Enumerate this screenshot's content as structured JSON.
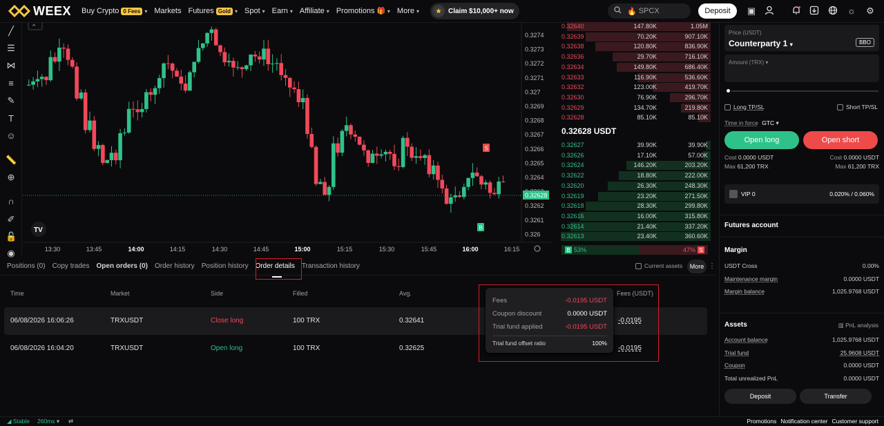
{
  "brand": {
    "name": "WEEX"
  },
  "nav": [
    {
      "label": "Buy Crypto",
      "badge": "0 Fees",
      "chevron": true
    },
    {
      "label": "Markets",
      "chevron": false
    },
    {
      "label": "Futures",
      "badge": "Gold",
      "chevron": true
    },
    {
      "label": "Spot",
      "chevron": true
    },
    {
      "label": "Earn",
      "chevron": true
    },
    {
      "label": "Affiliate",
      "chevron": true
    },
    {
      "label": "Promotions",
      "badge": "🎁",
      "chevron": true
    },
    {
      "label": "More",
      "chevron": true
    }
  ],
  "claim_label": "Claim $10,000+ now",
  "search": {
    "placeholder": "SPCX"
  },
  "deposit_label": "Deposit",
  "chart": {
    "price_axis": [
      "0.3274",
      "0.3273",
      "0.3272",
      "0.3271",
      "0.327",
      "0.3269",
      "0.3268",
      "0.3267",
      "0.3266",
      "0.3265",
      "0.3264",
      "0.3263",
      "0.3262",
      "0.3261",
      "0.326"
    ],
    "current_price": "0.32628",
    "time_axis": [
      "13:30",
      "13:45",
      "14:00",
      "14:15",
      "14:30",
      "14:45",
      "15:00",
      "15:15",
      "15:30",
      "15:45",
      "16:00",
      "16:15"
    ],
    "bold_times": [
      "14:00",
      "15:00",
      "16:00"
    ],
    "markers": {
      "sell": "S",
      "buy": "B"
    },
    "up_color": "#2ec28a",
    "down_color": "#f1495a",
    "tv_logo": "TV"
  },
  "orderbook": {
    "asks": [
      {
        "price": "0.32640",
        "amount": "147.80K",
        "total": "1.05M",
        "depth": 0.92
      },
      {
        "price": "0.32639",
        "amount": "70.20K",
        "total": "907.10K",
        "depth": 0.8
      },
      {
        "price": "0.32638",
        "amount": "120.80K",
        "total": "836.90K",
        "depth": 0.74
      },
      {
        "price": "0.32636",
        "amount": "29.70K",
        "total": "716.10K",
        "depth": 0.63
      },
      {
        "price": "0.32634",
        "amount": "149.80K",
        "total": "686.40K",
        "depth": 0.6
      },
      {
        "price": "0.32633",
        "amount": "116.90K",
        "total": "536.60K",
        "depth": 0.47
      },
      {
        "price": "0.32632",
        "amount": "123.00K",
        "total": "419.70K",
        "depth": 0.37
      },
      {
        "price": "0.32630",
        "amount": "76.90K",
        "total": "296.70K",
        "depth": 0.26
      },
      {
        "price": "0.32629",
        "amount": "134.70K",
        "total": "219.80K",
        "depth": 0.19
      },
      {
        "price": "0.32628",
        "amount": "85.10K",
        "total": "85.10K",
        "depth": 0.08
      }
    ],
    "mid_price": "0.32628 USDT",
    "bids": [
      {
        "price": "0.32627",
        "amount": "39.90K",
        "total": "39.90K",
        "depth": 0.03
      },
      {
        "price": "0.32626",
        "amount": "17.10K",
        "total": "57.00K",
        "depth": 0.05
      },
      {
        "price": "0.32624",
        "amount": "146.20K",
        "total": "203.20K",
        "depth": 0.54
      },
      {
        "price": "0.32622",
        "amount": "18.80K",
        "total": "222.00K",
        "depth": 0.59
      },
      {
        "price": "0.32620",
        "amount": "26.30K",
        "total": "248.30K",
        "depth": 0.66
      },
      {
        "price": "0.32619",
        "amount": "23.20K",
        "total": "271.50K",
        "depth": 0.72
      },
      {
        "price": "0.32618",
        "amount": "28.30K",
        "total": "299.80K",
        "depth": 0.8
      },
      {
        "price": "0.32616",
        "amount": "16.00K",
        "total": "315.80K",
        "depth": 0.84
      },
      {
        "price": "0.32614",
        "amount": "21.40K",
        "total": "337.20K",
        "depth": 0.9
      },
      {
        "price": "0.32613",
        "amount": "23.40K",
        "total": "360.60K",
        "depth": 0.96
      }
    ],
    "buy_ratio": "53%",
    "sell_ratio": "47%",
    "buy_letter": "B",
    "sell_letter": "S"
  },
  "trade_panel": {
    "price_label": "Price (USDT)",
    "price_value": "Counterparty 1",
    "bbo": "BBO",
    "amount_label": "Amount (TRX)",
    "long_tpsl": "Long TP/SL",
    "short_tpsl": "Short TP/SL",
    "tif_label": "Time in force",
    "tif_value": "GTC",
    "open_long": "Open long",
    "open_short": "Open short",
    "cost_left_label": "Cost",
    "cost_left": "0.0000 USDT",
    "cost_right_label": "Cost",
    "cost_right": "0.0000 USDT",
    "max_left_label": "Max",
    "max_left": "61,200 TRX",
    "max_right_label": "Max",
    "max_right": "61,200 TRX",
    "vip": "VIP 0",
    "fee_rate": "0.020% / 0.060%"
  },
  "account": {
    "title": "Futures account",
    "margin_title": "Margin",
    "margin_rows": [
      {
        "label": "USDT Cross",
        "value": "0.00%",
        "underline": false
      },
      {
        "label": "Maintenance margin",
        "value": "0.0000 USDT",
        "underline": true
      },
      {
        "label": "Margin balance",
        "value": "1,025.9768 USDT",
        "underline": true
      }
    ],
    "assets_title": "Assets",
    "pnl_analysis": "PnL analysis",
    "asset_rows": [
      {
        "label": "Account balance",
        "value": "1,025.9768 USDT",
        "underline": true
      },
      {
        "label": "Trial fund",
        "value": "25.9608 USDT",
        "underline": true
      },
      {
        "label": "Coupon",
        "value": "0.0000 USDT",
        "underline": true
      },
      {
        "label": "Total unrealized PnL",
        "value": "0.0000 USDT",
        "underline": false
      }
    ],
    "deposit": "Deposit",
    "transfer": "Transfer"
  },
  "tabs": [
    {
      "label": "Positions (0)",
      "style": "normal"
    },
    {
      "label": "Copy trades",
      "style": "normal"
    },
    {
      "label": "Open orders (0)",
      "style": "bold"
    },
    {
      "label": "Order history",
      "style": "normal"
    },
    {
      "label": "Position history",
      "style": "normal"
    },
    {
      "label": "Order details",
      "style": "active"
    },
    {
      "label": "Transaction history",
      "style": "normal"
    }
  ],
  "current_assets": "Current assets",
  "more_label": "More",
  "orders": {
    "columns": [
      "Time",
      "Market",
      "Side",
      "Filled",
      "Avg.",
      "Fees (USDT)"
    ],
    "rows": [
      {
        "time": "06/08/2026 16:06:26",
        "market": "TRXUSDT",
        "side": "Close long",
        "side_color": "#f1495a",
        "filled": "100 TRX",
        "avg": "0.32641",
        "fees": "-0.0195"
      },
      {
        "time": "06/08/2026 16:04:20",
        "market": "TRXUSDT",
        "side": "Open long",
        "side_color": "#2ec28a",
        "filled": "100 TRX",
        "avg": "0.32625",
        "fees": "-0.0195"
      }
    ]
  },
  "tooltip": {
    "rows": [
      {
        "label": "Fees",
        "value": "-0.0195 USDT",
        "color": "#f1495a"
      },
      {
        "label": "Coupon discount",
        "value": "0.0000 USDT",
        "color": "#ffffff"
      },
      {
        "label": "Trial fund applied",
        "value": "-0.0195 USDT",
        "color": "#f1495a"
      }
    ],
    "offset_label": "Trial fund offset ratio",
    "offset_value": "100%"
  },
  "status": {
    "stable": "Stable",
    "latency": "260ms",
    "links": [
      "Promotions",
      "Notification center",
      "Customer support"
    ]
  }
}
